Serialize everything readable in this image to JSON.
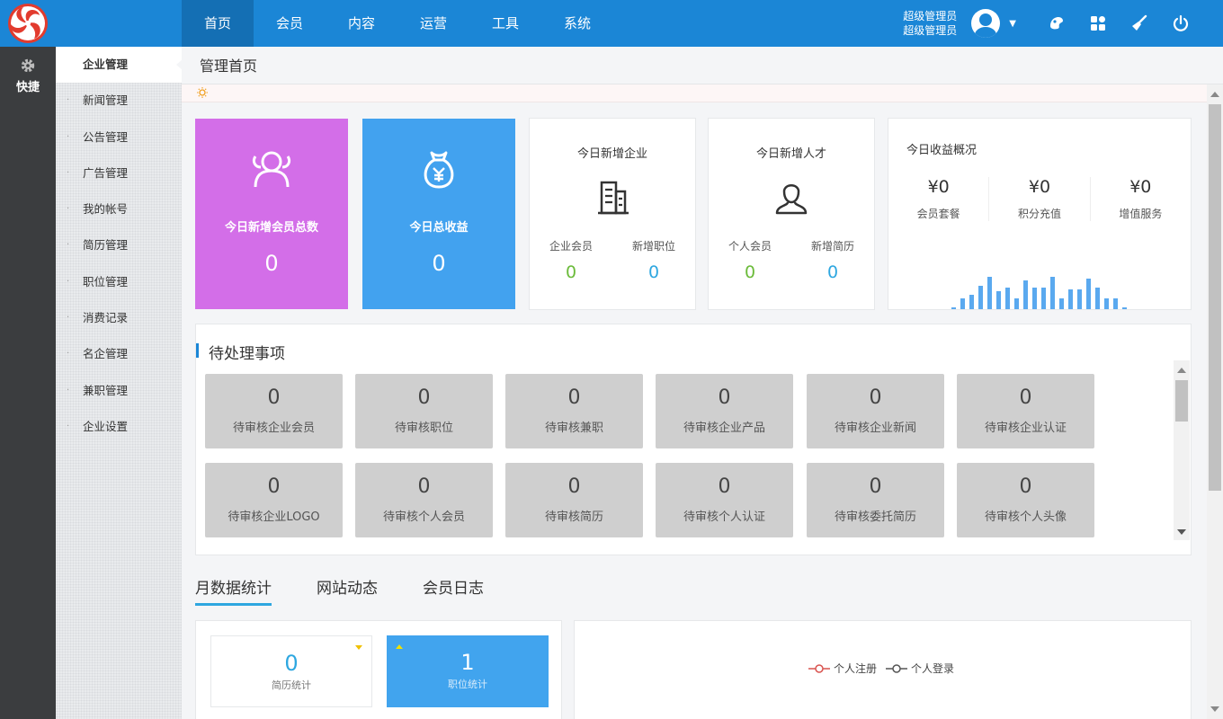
{
  "topnav": [
    "首页",
    "会员",
    "内容",
    "运营",
    "工具",
    "系统"
  ],
  "user": {
    "name": "超级管理员",
    "role": "超级管理员"
  },
  "rail": {
    "label": "快捷"
  },
  "submenu": [
    "企业管理",
    "新闻管理",
    "公告管理",
    "广告管理",
    "我的帐号",
    "简历管理",
    "职位管理",
    "消费记录",
    "名企管理",
    "兼职管理",
    "企业设置"
  ],
  "page": {
    "title": "管理首页"
  },
  "stats": {
    "new_members": {
      "label": "今日新增会员总数",
      "value": "0",
      "color": "#d36ee8"
    },
    "income_total": {
      "label": "今日总收益",
      "value": "0",
      "color": "#42a2ef"
    },
    "new_companies": {
      "title": "今日新增企业",
      "left_label": "企业会员",
      "left_value": "0",
      "right_label": "新增职位",
      "right_value": "0"
    },
    "new_talents": {
      "title": "今日新增人才",
      "left_label": "个人会员",
      "left_value": "0",
      "right_label": "新增简历",
      "right_value": "0"
    }
  },
  "income": {
    "title": "今日收益概况",
    "cols": [
      {
        "amount": "¥0",
        "label": "会员套餐"
      },
      {
        "amount": "¥0",
        "label": "积分充值"
      },
      {
        "amount": "¥0",
        "label": "增值服务"
      }
    ]
  },
  "pending": {
    "title": "待处理事项",
    "items": [
      {
        "count": "0",
        "label": "待审核企业会员"
      },
      {
        "count": "0",
        "label": "待审核职位"
      },
      {
        "count": "0",
        "label": "待审核兼职"
      },
      {
        "count": "0",
        "label": "待审核企业产品"
      },
      {
        "count": "0",
        "label": "待审核企业新闻"
      },
      {
        "count": "0",
        "label": "待审核企业认证"
      },
      {
        "count": "0",
        "label": "待审核企业LOGO"
      },
      {
        "count": "0",
        "label": "待审核个人会员"
      },
      {
        "count": "0",
        "label": "待审核简历"
      },
      {
        "count": "0",
        "label": "待审核个人认证"
      },
      {
        "count": "0",
        "label": "待审核委托简历"
      },
      {
        "count": "0",
        "label": "待审核个人头像"
      }
    ]
  },
  "tabs": [
    "月数据统计",
    "网站动态",
    "会员日志"
  ],
  "mini": {
    "resume": {
      "value": "0",
      "label": "简历统计"
    },
    "job": {
      "value": "1",
      "label": "职位统计"
    }
  },
  "legend": [
    "个人注册",
    "个人登录"
  ],
  "colors": {
    "topbar": "#1b86d6",
    "accent": "#2ea7e0",
    "green": "#6bbb3a",
    "reg_line": "#d9534f",
    "login_line": "#555555"
  }
}
